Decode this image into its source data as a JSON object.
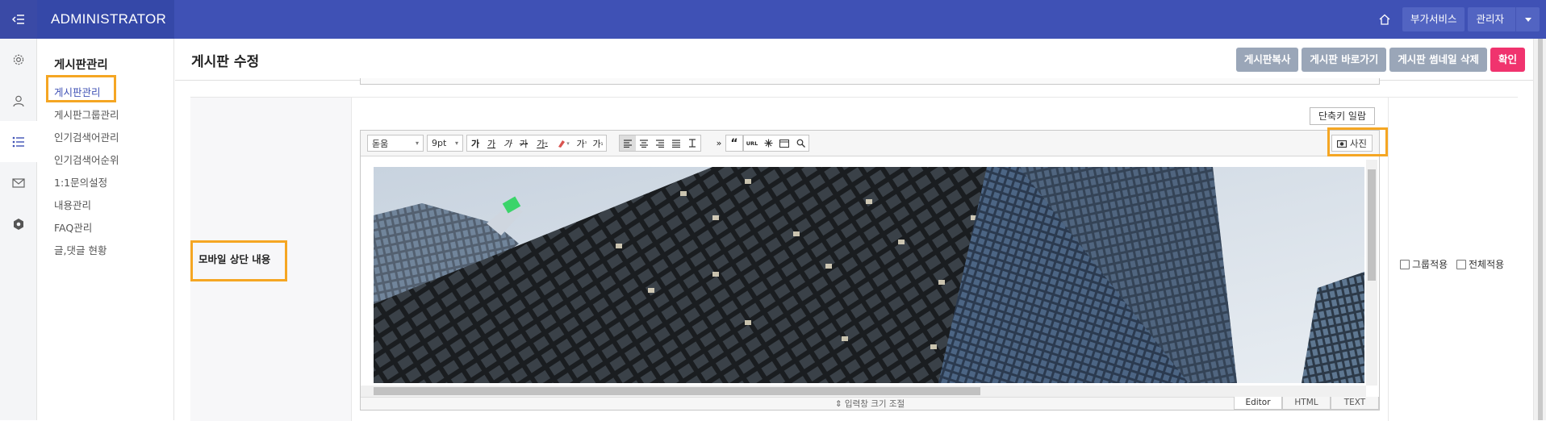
{
  "topbar": {
    "brand": "ADMINISTRATOR",
    "extra_service": "부가서비스",
    "user": "관리자"
  },
  "rail_icons": [
    "gear-icon",
    "user-icon",
    "list-icon",
    "mail-icon",
    "hexagon-icon"
  ],
  "subnav": {
    "title": "게시판관리",
    "items": [
      "게시판관리",
      "게시판그룹관리",
      "인기검색어관리",
      "인기검색어순위",
      "1:1문의설정",
      "내용관리",
      "FAQ관리",
      "글,댓글 현황"
    ],
    "active_index": 0
  },
  "page": {
    "title": "게시판 수정",
    "buttons": {
      "copy": "게시판복사",
      "goto": "게시판 바로가기",
      "delete_thumb": "게시판 썸네일 삭제",
      "confirm": "확인"
    }
  },
  "form": {
    "row_label": "모바일 상단 내용",
    "shortcut_button": "단축키 일람",
    "group_apply": "그룹적용",
    "all_apply": "전체적용"
  },
  "editor": {
    "font_family": "돋움",
    "font_size": "9pt",
    "photo_button": "사진",
    "resize_label": "⇕ 입력창 크기 조절",
    "modes": [
      "Editor",
      "HTML",
      "TEXT"
    ],
    "active_mode": "Editor"
  },
  "colors": {
    "topbar": "#3f51b5",
    "confirm": "#f0336e",
    "highlight": "#f5a623"
  }
}
